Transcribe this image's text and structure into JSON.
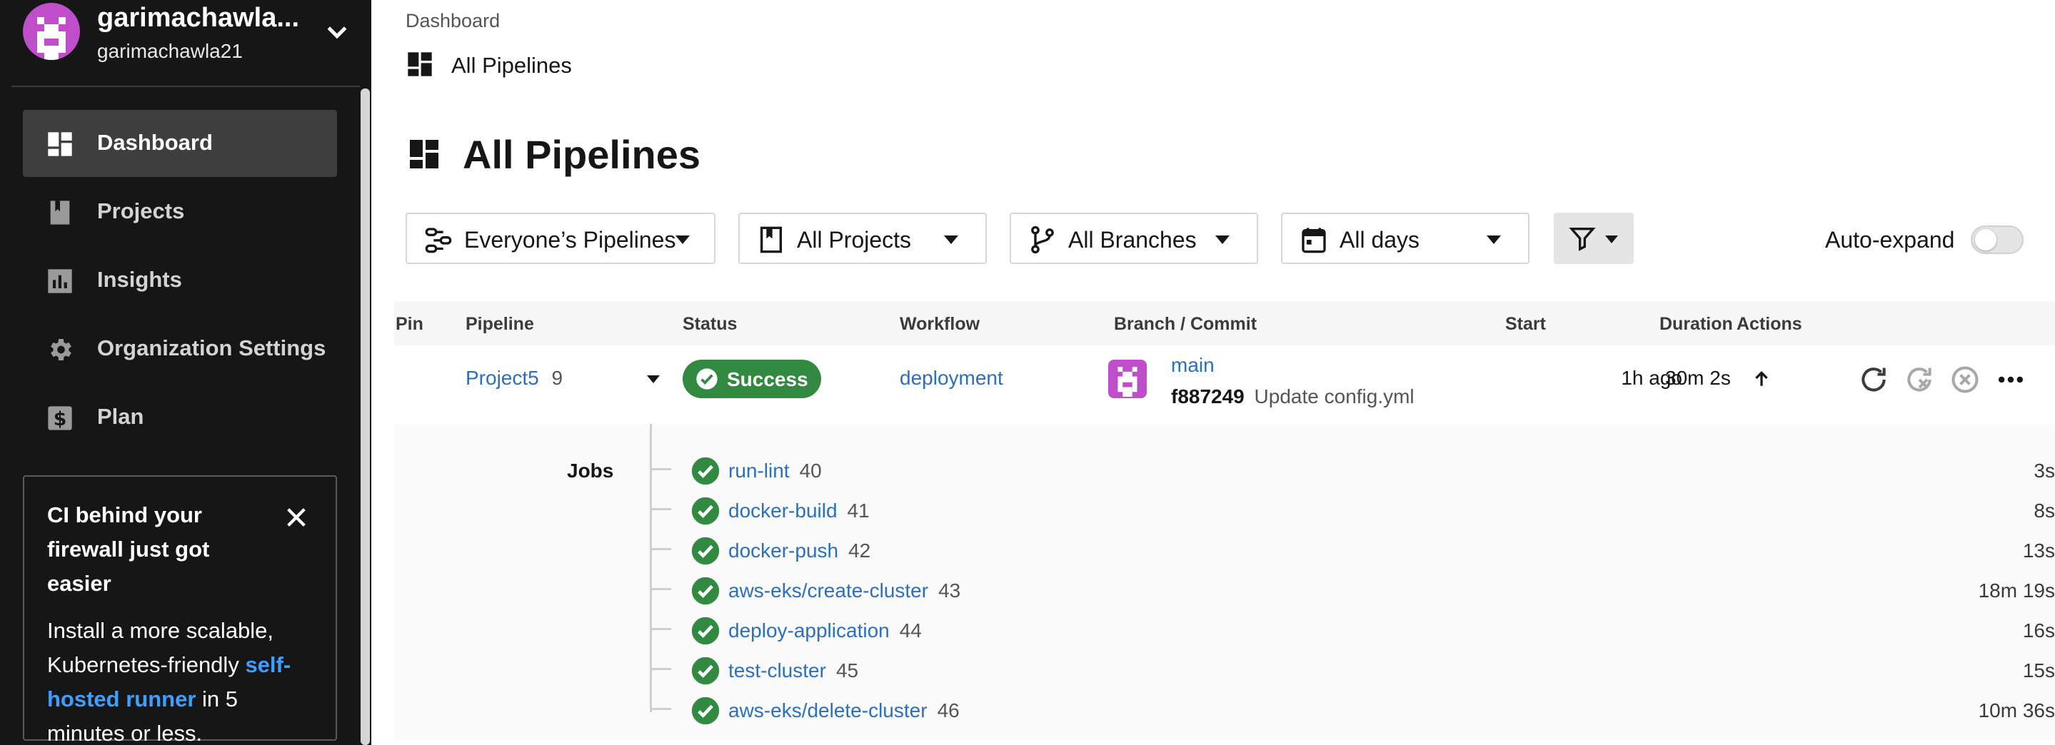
{
  "org": {
    "name": "garimachawla...",
    "user": "garimachawla21"
  },
  "nav": {
    "items": [
      {
        "label": "Dashboard",
        "icon": "dashboard-icon",
        "active": true
      },
      {
        "label": "Projects",
        "icon": "book-icon",
        "active": false
      },
      {
        "label": "Insights",
        "icon": "bar-chart-icon",
        "active": false
      },
      {
        "label": "Organization Settings",
        "icon": "gear-icon",
        "active": false
      },
      {
        "label": "Plan",
        "icon": "dollar-icon",
        "active": false
      }
    ]
  },
  "promo": {
    "title": "CI behind your firewall just got easier",
    "body_prefix": "Install a more scalable, Kubernetes-friendly ",
    "link": "self-hosted runner",
    "body_suffix": " in 5 minutes or less."
  },
  "breadcrumb": "Dashboard",
  "subtitle": "All Pipelines",
  "title": "All Pipelines",
  "filters": {
    "pipelines": "Everyone’s Pipelines",
    "projects": "All Projects",
    "branches": "All Branches",
    "days": "All days"
  },
  "auto_expand": {
    "label": "Auto-expand",
    "enabled": false
  },
  "table": {
    "headers": {
      "pin": "Pin",
      "pipeline": "Pipeline",
      "status": "Status",
      "workflow": "Workflow",
      "branch_commit": "Branch / Commit",
      "start": "Start",
      "duration": "Duration",
      "actions": "Actions"
    },
    "row": {
      "project": "Project5",
      "number": "9",
      "status": "Success",
      "workflow": "deployment",
      "branch": "main",
      "commit_sha": "f887249",
      "commit_msg": "Update config.yml",
      "start": "1h ago",
      "duration": "30m 2s"
    }
  },
  "jobs": {
    "label": "Jobs",
    "items": [
      {
        "name": "run-lint",
        "number": "40",
        "duration": "3s"
      },
      {
        "name": "docker-build",
        "number": "41",
        "duration": "8s"
      },
      {
        "name": "docker-push",
        "number": "42",
        "duration": "13s"
      },
      {
        "name": "aws-eks/create-cluster",
        "number": "43",
        "duration": "18m 19s"
      },
      {
        "name": "deploy-application",
        "number": "44",
        "duration": "16s"
      },
      {
        "name": "test-cluster",
        "number": "45",
        "duration": "15s"
      },
      {
        "name": "aws-eks/delete-cluster",
        "number": "46",
        "duration": "10m 36s"
      }
    ]
  },
  "colors": {
    "sidebar_bg": "#161616",
    "success": "#318a3f",
    "link": "#2a6fc0",
    "avatar": "#c04ecb"
  }
}
